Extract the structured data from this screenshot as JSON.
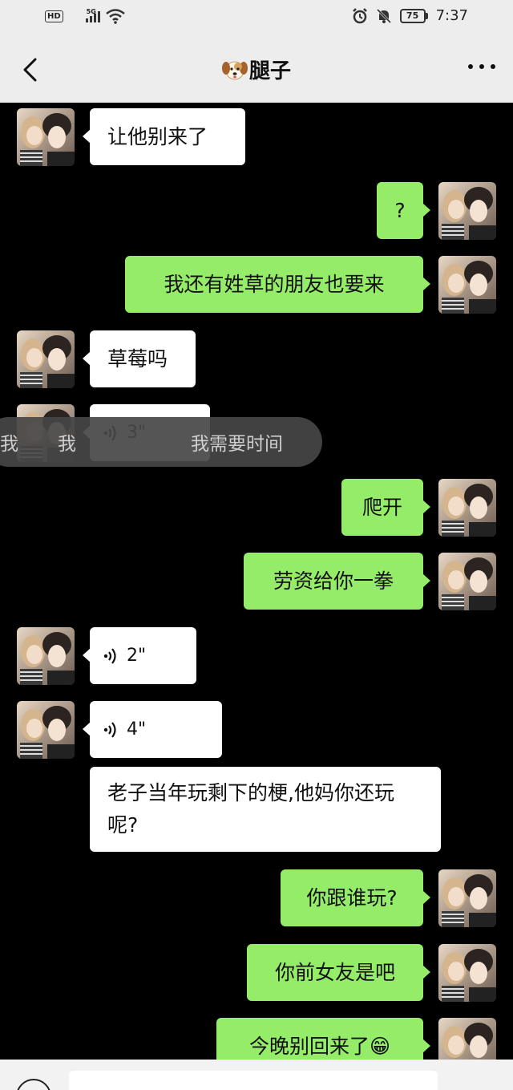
{
  "status_bar": {
    "network_badge": "HD",
    "signal_label": "5G",
    "battery": "75",
    "time": "7:37"
  },
  "header": {
    "title": "腿子"
  },
  "toast": {
    "left": "我",
    "middle": "我",
    "right": "我需要时间"
  },
  "messages": [
    {
      "side": "left",
      "type": "text",
      "text": "让他别来了"
    },
    {
      "side": "right",
      "type": "text",
      "text": "?"
    },
    {
      "side": "right",
      "type": "text",
      "text": "我还有姓草的朋友也要来"
    },
    {
      "side": "left",
      "type": "text",
      "text": "草莓吗"
    },
    {
      "side": "left",
      "type": "voice",
      "text": "3\""
    },
    {
      "side": "right",
      "type": "text",
      "text": "爬开"
    },
    {
      "side": "right",
      "type": "text",
      "text": "劳资给你一拳"
    },
    {
      "side": "left",
      "type": "voice",
      "text": "2\""
    },
    {
      "side": "left",
      "type": "voice",
      "text": "4\""
    },
    {
      "side": "left",
      "type": "text",
      "text": "老子当年玩剩下的梗,他妈你还玩呢?"
    },
    {
      "side": "right",
      "type": "text",
      "text": "你跟谁玩?"
    },
    {
      "side": "right",
      "type": "text",
      "text": "你前女友是吧"
    },
    {
      "side": "right",
      "type": "text",
      "text": "今晚别回来了😁"
    }
  ]
}
